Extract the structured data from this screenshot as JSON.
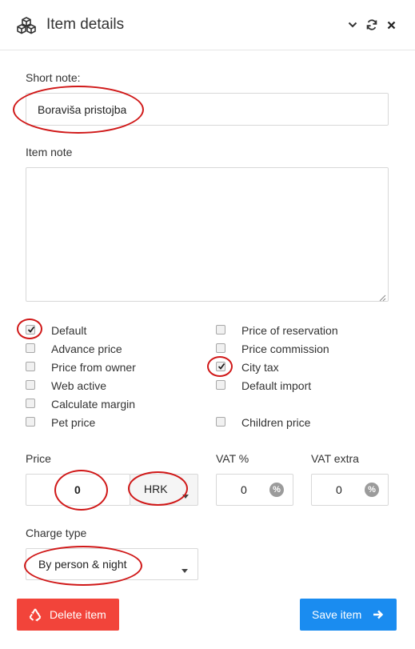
{
  "header": {
    "title": "Item details",
    "icons": [
      "cubes-icon",
      "chevron-down-icon",
      "refresh-icon",
      "close-icon"
    ]
  },
  "short_note": {
    "label": "Short note:",
    "value": "Boraviša pristojba"
  },
  "item_note": {
    "label": "Item note",
    "value": ""
  },
  "checkboxes": {
    "default": {
      "label": "Default",
      "checked": true
    },
    "advance_price": {
      "label": "Advance price",
      "checked": false
    },
    "price_from_owner": {
      "label": "Price from owner",
      "checked": false
    },
    "web_active": {
      "label": "Web active",
      "checked": false
    },
    "calculate_margin": {
      "label": "Calculate margin",
      "checked": false
    },
    "pet_price": {
      "label": "Pet price",
      "checked": false
    },
    "price_of_reservation": {
      "label": "Price of reservation",
      "checked": false
    },
    "price_commission": {
      "label": "Price commission",
      "checked": false
    },
    "city_tax": {
      "label": "City tax",
      "checked": true
    },
    "default_import": {
      "label": "Default import",
      "checked": false
    },
    "children_price": {
      "label": "Children price",
      "checked": false
    }
  },
  "price": {
    "label": "Price",
    "value": "0",
    "currency": "HRK"
  },
  "vat": {
    "label": "VAT %",
    "value": "0",
    "suffix": "%"
  },
  "vat_extra": {
    "label": "VAT extra",
    "value": "0",
    "suffix": "%"
  },
  "charge_type": {
    "label": "Charge type",
    "value": "By person & night"
  },
  "buttons": {
    "delete": "Delete item",
    "save": "Save item"
  },
  "colors": {
    "delete": "#f2443a",
    "save": "#1a8cf0",
    "annotation": "#d01818"
  }
}
